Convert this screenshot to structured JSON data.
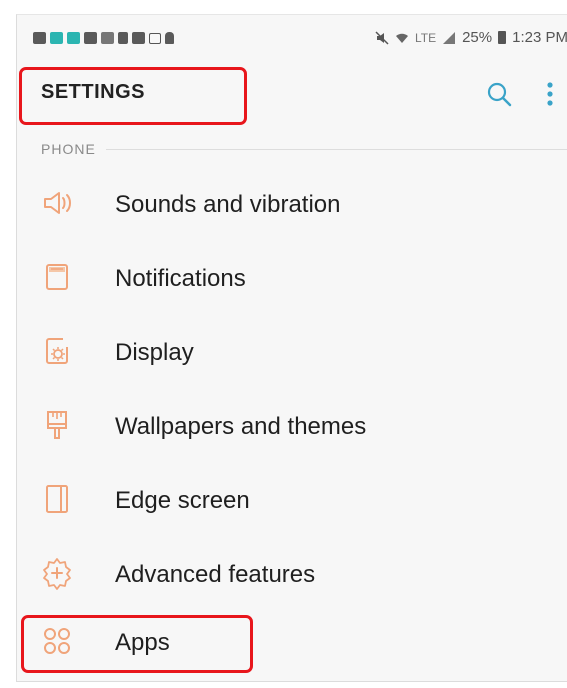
{
  "statusbar": {
    "battery": "25%",
    "time": "1:23 PM",
    "network": "LTE"
  },
  "header": {
    "title": "SETTINGS"
  },
  "section": {
    "label": "PHONE"
  },
  "items": [
    {
      "label": "Sounds and vibration",
      "icon": "speaker-icon"
    },
    {
      "label": "Notifications",
      "icon": "notification-icon"
    },
    {
      "label": "Display",
      "icon": "display-icon"
    },
    {
      "label": "Wallpapers and themes",
      "icon": "brush-icon"
    },
    {
      "label": "Edge screen",
      "icon": "edge-screen-icon"
    },
    {
      "label": "Advanced features",
      "icon": "gear-plus-icon"
    },
    {
      "label": "Apps",
      "icon": "apps-icon"
    }
  ],
  "colors": {
    "icon_accent": "#f0a47a",
    "highlight": "#e8161c",
    "search_icon": "#3aa3c8"
  }
}
